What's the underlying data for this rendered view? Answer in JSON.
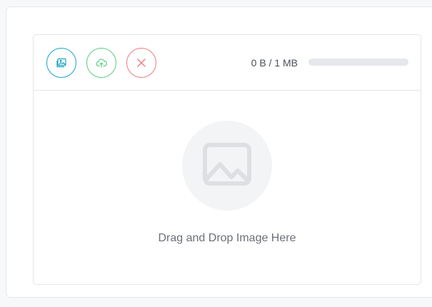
{
  "uploader": {
    "buttons": {
      "choose": {
        "icon": "image-icon",
        "color": "#17a2c8"
      },
      "upload": {
        "icon": "cloud-upload-icon",
        "color": "#5ccb7f"
      },
      "cancel": {
        "icon": "close-icon",
        "color": "#ef7b80"
      }
    },
    "size_text": "0 B / 1 MB",
    "progress": {
      "value": 0,
      "max": 1,
      "unit": "MB"
    },
    "dropzone": {
      "icon": "image-placeholder-icon",
      "label": "Drag and Drop Image Here"
    }
  }
}
